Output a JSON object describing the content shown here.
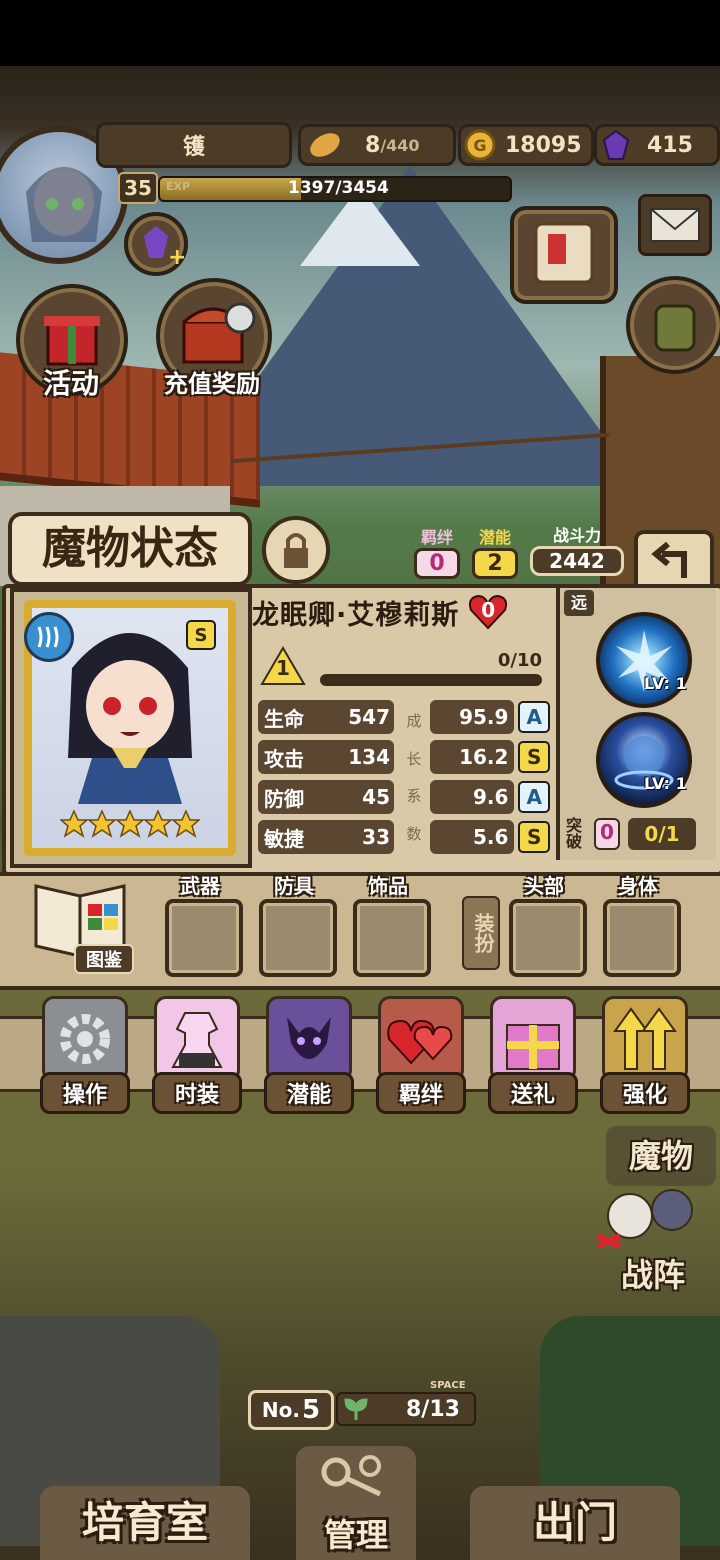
{
  "hud": {
    "player_name": "镬",
    "level": "35",
    "exp_label": "EXP",
    "exp": "1397/3454",
    "exp_fraction": 0.404,
    "stamina": "8",
    "stamina_max": "/440",
    "gold": "18095",
    "gems": "415"
  },
  "left_buttons": {
    "activity": "活动",
    "recharge": "充值奖励"
  },
  "header": {
    "title": "魔物状态",
    "bond_label": "羁绊",
    "bond_value": "0",
    "potential_label": "潜能",
    "potential_value": "2",
    "power_label": "战斗力",
    "power_value": "2442"
  },
  "monster": {
    "name": "龙眠卿·艾穆莉斯",
    "heart_count": "0",
    "rank_badge": "S",
    "stars": 5,
    "potential_level": "1",
    "potential_progress": "0/10",
    "potential_fraction": 0,
    "growth_label": [
      "成",
      "长",
      "系",
      "数"
    ],
    "stats": [
      {
        "name": "生命",
        "value": "547",
        "growth": "95.9",
        "grade": "A"
      },
      {
        "name": "攻击",
        "value": "134",
        "growth": "16.2",
        "grade": "S"
      },
      {
        "name": "防御",
        "value": "45",
        "growth": "9.6",
        "grade": "A"
      },
      {
        "name": "敏捷",
        "value": "33",
        "growth": "5.6",
        "grade": "S"
      }
    ]
  },
  "skills": {
    "range_label": "远",
    "skill1_level": "LV: 1",
    "skill2_level": "LV: 1",
    "breakthrough_label": "突破",
    "breakthrough_value": "0",
    "breakthrough_progress": "0/1"
  },
  "equipment": {
    "codex_label": "图鉴",
    "weapon": "武器",
    "armor": "防具",
    "accessory": "饰品",
    "dress_label": "装扮",
    "head": "头部",
    "body": "身体"
  },
  "actions": [
    "操作",
    "时装",
    "潜能",
    "羁绊",
    "送礼",
    "强化"
  ],
  "side": {
    "monsters": "魔物",
    "formation": "战阵"
  },
  "footer": {
    "no_label": "No.",
    "no_value": "5",
    "space_label": "SPACE",
    "capacity": "8/13",
    "nursery": "培育室",
    "manage": "管理",
    "go_out": "出门"
  },
  "colors": {
    "hud_bg": "#4b3b27",
    "panel_bg": "#d9c9a6",
    "grade_S": "#f4d84a",
    "grade_A": "#e4f3fb",
    "accent_pink": "#f0c0d8",
    "gold_text": "#f0c040"
  }
}
